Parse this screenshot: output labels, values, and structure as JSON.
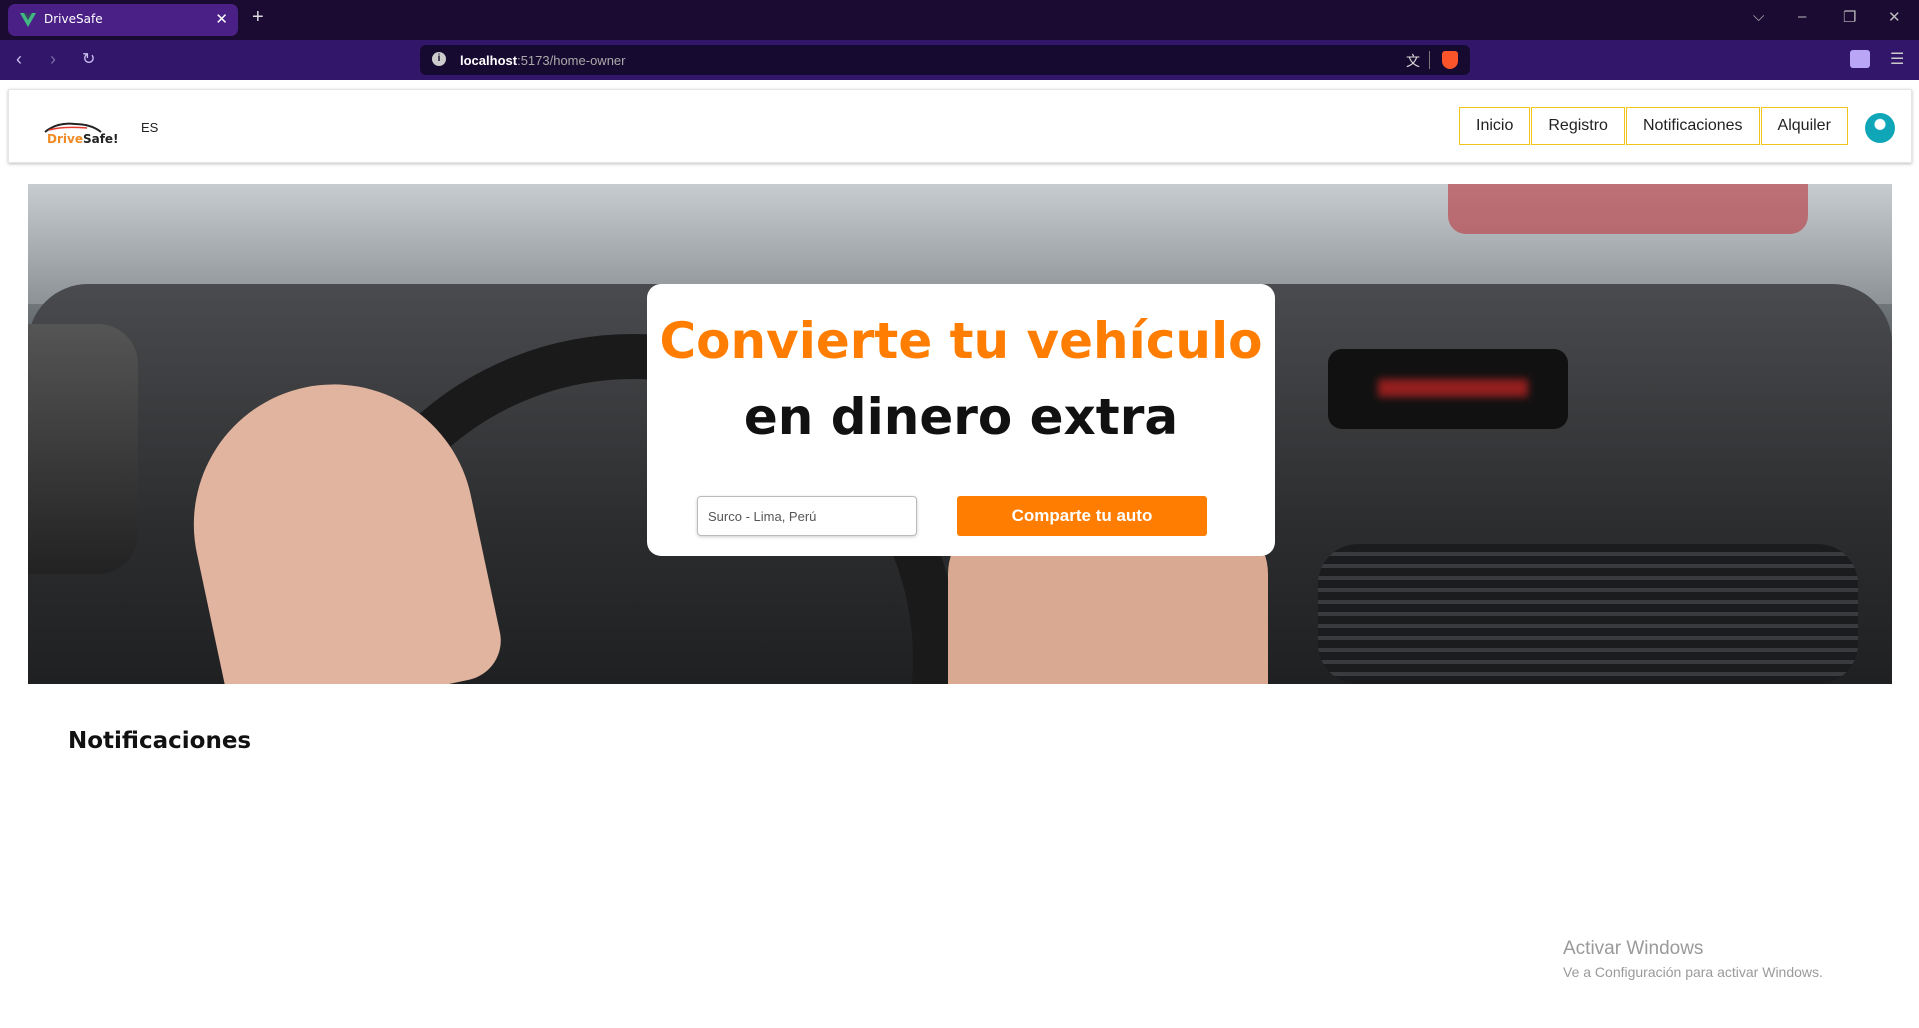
{
  "browser": {
    "tab_title": "DriveSafe",
    "tab_close": "✕",
    "new_tab": "+",
    "url_host": "localhost",
    "url_path": ":5173/home-owner",
    "window_controls": [
      "⌵",
      "–",
      "❐",
      "✕"
    ]
  },
  "header": {
    "logo_text_drive": "Drive",
    "logo_text_safe": "Safe!",
    "language": "ES",
    "nav": [
      "Inicio",
      "Registro",
      "Notificaciones",
      "Alquiler"
    ]
  },
  "hero": {
    "title_line_1": "Convierte tu vehículo",
    "title_line_2": "en dinero extra",
    "location_placeholder": "Surco - Lima, Perú",
    "share_button": "Comparte tu auto"
  },
  "notifications": {
    "title": "Notificaciones"
  },
  "windows_watermark": {
    "title": "Activar Windows",
    "subtitle": "Ve a Configuración para activar Windows."
  },
  "colors": {
    "accent": "#ff7d00",
    "nav_border": "#f0c419",
    "tabbar": "#1b0b33",
    "addressbar": "#321669"
  }
}
